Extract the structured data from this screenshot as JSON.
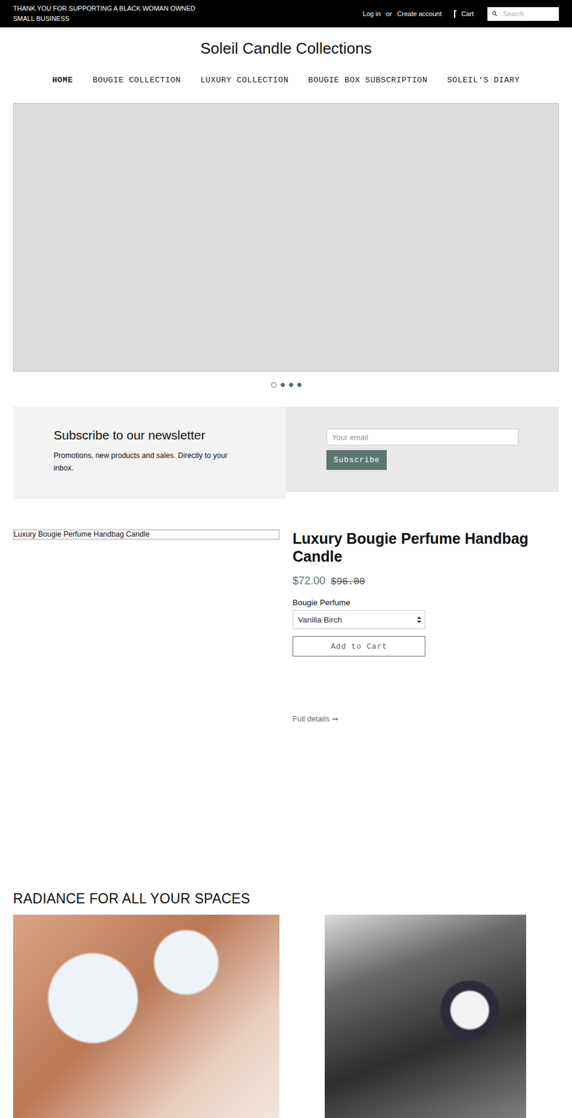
{
  "announcement": "THANK YOU FOR SUPPORTING A BLACK WOMAN OWNED SMALL BUSINESS",
  "account": {
    "login": "Log in",
    "separator": "or",
    "register": "Create account"
  },
  "cart": "Cart",
  "search": {
    "placeholder": "Search"
  },
  "store_title": "Soleil Candle Collections",
  "nav": [
    {
      "label": "HOME",
      "selected": true
    },
    {
      "label": "BOUGIE COLLECTION",
      "selected": false
    },
    {
      "label": "LUXURY COLLECTION",
      "selected": false
    },
    {
      "label": "BOUGIE BOX SUBSCRIPTION",
      "selected": false
    },
    {
      "label": "SOLEIL'S DIARY",
      "selected": false
    }
  ],
  "slideshow": {
    "dots": [
      {
        "selected": true
      },
      {
        "selected": false
      },
      {
        "selected": false
      },
      {
        "selected": false
      }
    ]
  },
  "newsletter": {
    "title": "Subscribe to our newsletter",
    "text": "Promotions, new products and sales. Directly to your inbox.",
    "placeholder": "Your email",
    "button": "Subscribe"
  },
  "product": {
    "image_alt": "Luxury Bougie Perfume Handbag Candle",
    "title": "Luxury Bougie Perfume Handbag Candle",
    "price": "$72.00",
    "compare_price": "$96.00",
    "option_label": "Bougie Perfume",
    "option_value": "Vanilla Birch",
    "add_button": "Add to Cart",
    "details_link": "Full details ➞"
  },
  "gallery": {
    "title": "RADIANCE FOR ALL YOUR SPACES"
  }
}
